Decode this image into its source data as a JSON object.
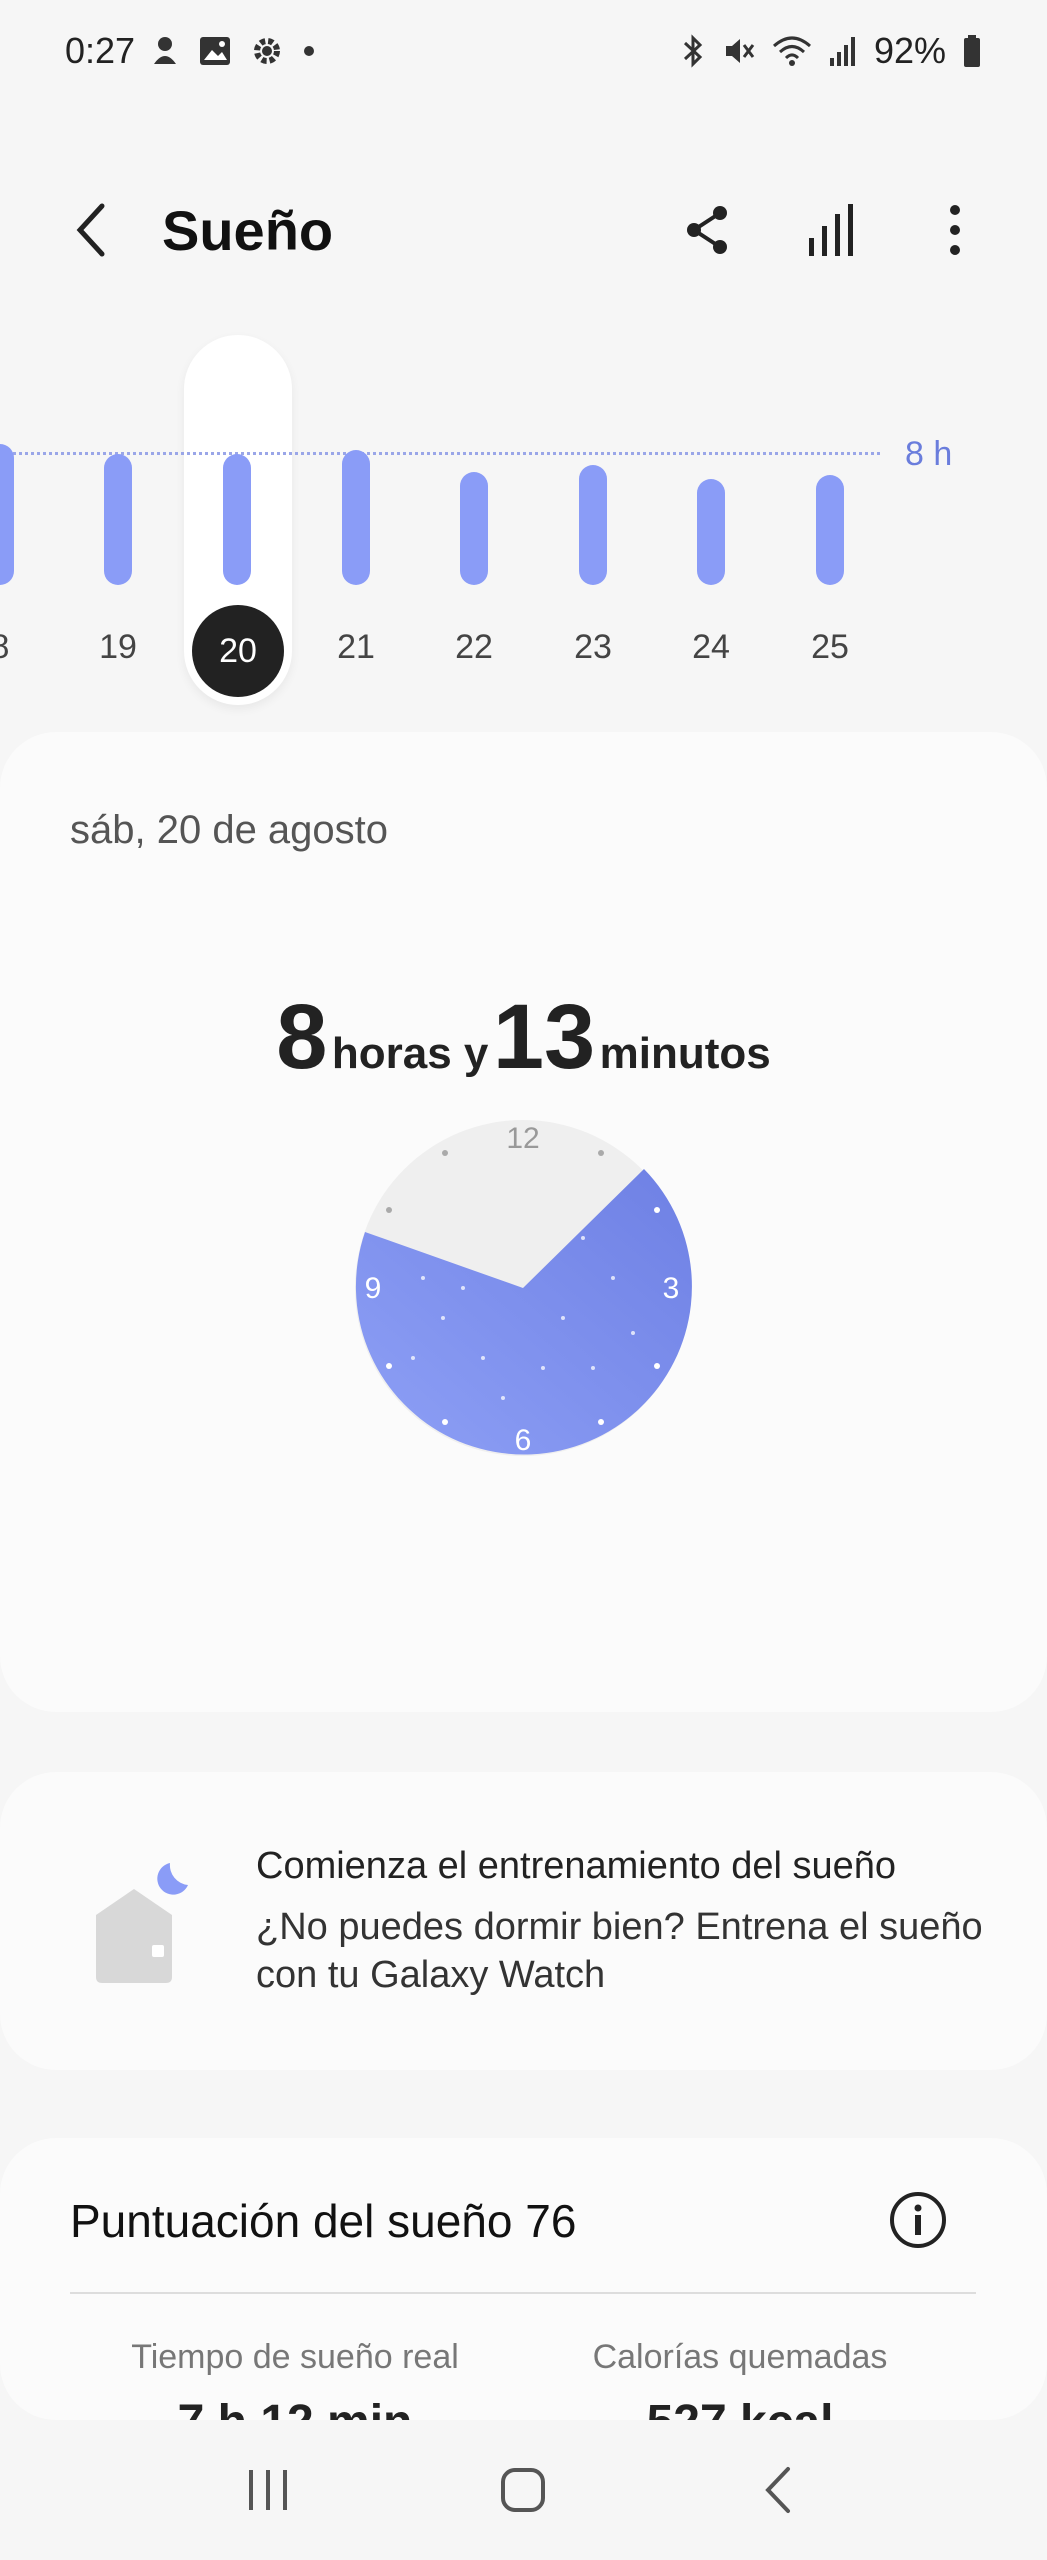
{
  "status_bar": {
    "time": "0:27",
    "battery": "92%"
  },
  "app_bar": {
    "title": "Sueño",
    "icons": [
      "back-arrow-icon",
      "share-icon",
      "bar-chart-icon",
      "more-vertical-icon"
    ]
  },
  "day_chart": {
    "goal_label": "8 h",
    "selected_day": "20",
    "days": [
      "8",
      "19",
      "20",
      "21",
      "22",
      "23",
      "24",
      "25"
    ],
    "bar_heights_hours": [
      8.5,
      7.9,
      7.9,
      8.1,
      6.8,
      7.2,
      6.4,
      6.6
    ],
    "accent": "#8a9cf7"
  },
  "summary": {
    "date": "sáb, 20 de agosto",
    "hours": "8",
    "hours_word": "horas y",
    "minutes": "13",
    "minutes_word": "minutos",
    "clock_labels": {
      "top": "12",
      "right": "3",
      "bottom": "6",
      "left": "9"
    }
  },
  "coaching": {
    "title": "Comienza el entrenamiento del sueño",
    "description": "¿No puedes dormir bien? Entrena el sueño con tu Galaxy Watch"
  },
  "score": {
    "label": "Puntuación del sueño 76",
    "stats": [
      {
        "label": "Tiempo de sueño real",
        "value": "7 h 12 min"
      },
      {
        "label": "Calorías quemadas",
        "value": "527 kcal"
      }
    ]
  }
}
